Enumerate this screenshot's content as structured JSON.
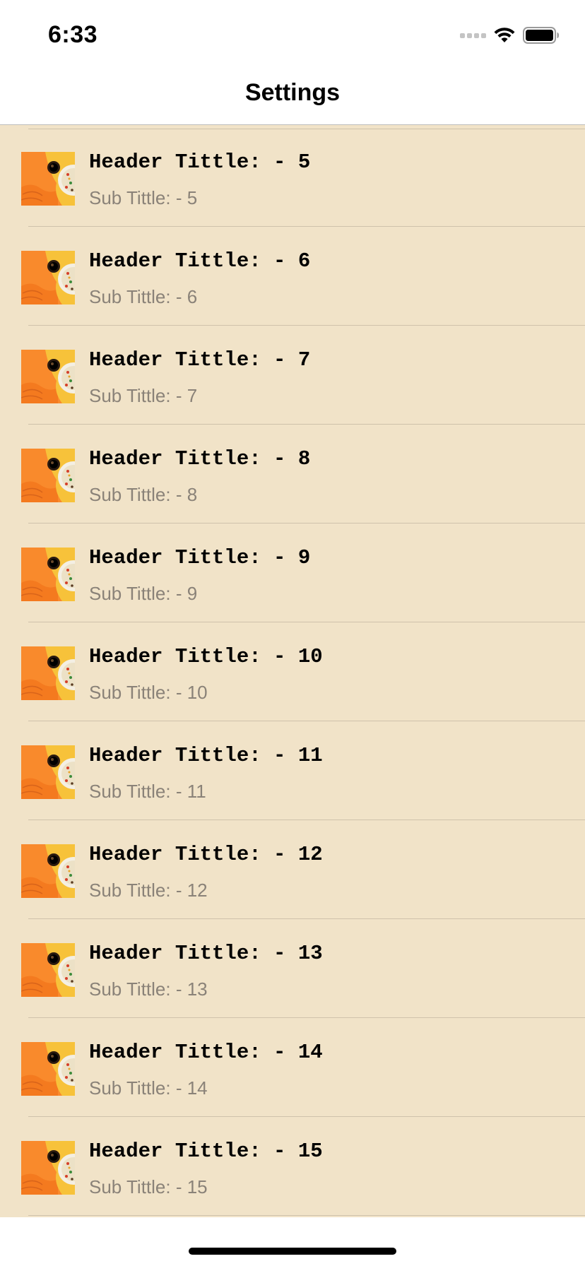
{
  "status_bar": {
    "time": "6:33"
  },
  "nav": {
    "title": "Settings"
  },
  "list": {
    "items": [
      {
        "title": "Header Tittle: - 5",
        "subtitle": "Sub Tittle: - 5"
      },
      {
        "title": "Header Tittle: - 6",
        "subtitle": "Sub Tittle: - 6"
      },
      {
        "title": "Header Tittle: - 7",
        "subtitle": "Sub Tittle: - 7"
      },
      {
        "title": "Header Tittle: - 8",
        "subtitle": "Sub Tittle: - 8"
      },
      {
        "title": "Header Tittle: - 9",
        "subtitle": "Sub Tittle: - 9"
      },
      {
        "title": "Header Tittle: - 10",
        "subtitle": "Sub Tittle: - 10"
      },
      {
        "title": "Header Tittle: - 11",
        "subtitle": "Sub Tittle: - 11"
      },
      {
        "title": "Header Tittle: - 12",
        "subtitle": "Sub Tittle: - 12"
      },
      {
        "title": "Header Tittle: - 13",
        "subtitle": "Sub Tittle: - 13"
      },
      {
        "title": "Header Tittle: - 14",
        "subtitle": "Sub Tittle: - 14"
      },
      {
        "title": "Header Tittle: - 15",
        "subtitle": "Sub Tittle: - 15"
      }
    ],
    "thumbnail_icon": "food-photo-icon"
  },
  "colors": {
    "list_background": "#f1e3c8",
    "separator": "#cfc2ab",
    "subtitle": "#8a8278",
    "thumb_orange": "#f98a2c",
    "thumb_yellow": "#f7c23a"
  }
}
